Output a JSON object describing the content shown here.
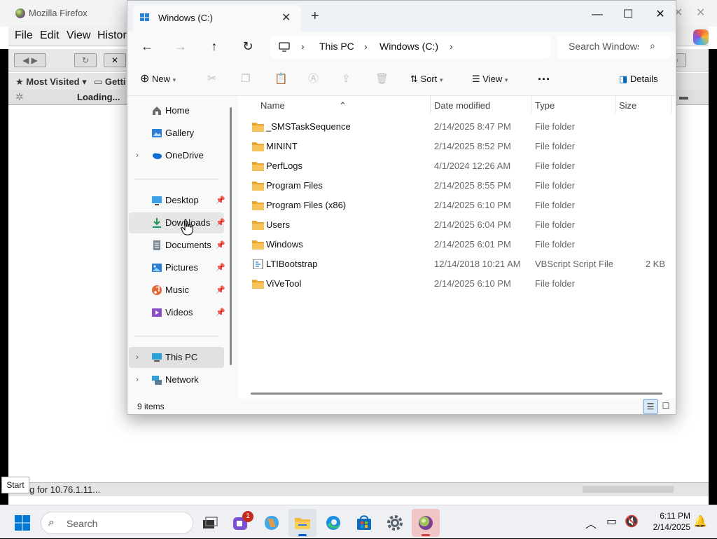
{
  "firefox": {
    "title": "Mozilla Firefox",
    "menu": [
      "File",
      "Edit",
      "View",
      "Histor"
    ],
    "bookmarks": [
      "Most Visited",
      "Getti"
    ],
    "tab_label": "Loading...",
    "status": "ing for 10.76.1.11..."
  },
  "tooltip": {
    "start": "Start"
  },
  "explorer": {
    "tab_title": "Windows (C:)",
    "breadcrumb": [
      "This PC",
      "Windows (C:)"
    ],
    "search_placeholder": "Search Windows (C:)",
    "commands": {
      "new": "New",
      "sort": "Sort",
      "view": "View",
      "details": "Details"
    },
    "nav": {
      "quick": [
        {
          "label": "Home",
          "icon": "home-icon"
        },
        {
          "label": "Gallery",
          "icon": "gallery-icon"
        },
        {
          "label": "OneDrive",
          "icon": "onedrive-icon"
        }
      ],
      "pinned": [
        {
          "label": "Desktop",
          "icon": "desktop-icon"
        },
        {
          "label": "Downloads",
          "icon": "downloads-icon"
        },
        {
          "label": "Documents",
          "icon": "documents-icon"
        },
        {
          "label": "Pictures",
          "icon": "pictures-icon"
        },
        {
          "label": "Music",
          "icon": "music-icon"
        },
        {
          "label": "Videos",
          "icon": "videos-icon"
        }
      ],
      "drives": [
        {
          "label": "This PC",
          "icon": "this-pc-icon"
        },
        {
          "label": "Network",
          "icon": "network-icon"
        }
      ]
    },
    "columns": {
      "name": "Name",
      "date": "Date modified",
      "type": "Type",
      "size": "Size"
    },
    "files": [
      {
        "name": "_SMSTaskSequence",
        "date": "2/14/2025 8:47 PM",
        "type": "File folder",
        "size": ""
      },
      {
        "name": "MININT",
        "date": "2/14/2025 8:52 PM",
        "type": "File folder",
        "size": ""
      },
      {
        "name": "PerfLogs",
        "date": "4/1/2024 12:26 AM",
        "type": "File folder",
        "size": ""
      },
      {
        "name": "Program Files",
        "date": "2/14/2025 8:55 PM",
        "type": "File folder",
        "size": ""
      },
      {
        "name": "Program Files (x86)",
        "date": "2/14/2025 6:10 PM",
        "type": "File folder",
        "size": ""
      },
      {
        "name": "Users",
        "date": "2/14/2025 6:04 PM",
        "type": "File folder",
        "size": ""
      },
      {
        "name": "Windows",
        "date": "2/14/2025 6:01 PM",
        "type": "File folder",
        "size": ""
      },
      {
        "name": "LTIBootstrap",
        "date": "12/14/2018 10:21 AM",
        "type": "VBScript Script File",
        "size": "2 KB"
      },
      {
        "name": "ViVeTool",
        "date": "2/14/2025 6:10 PM",
        "type": "File folder",
        "size": ""
      }
    ],
    "status": "9 items"
  },
  "taskbar": {
    "search_label": "Search",
    "chat_badge": "1",
    "time": "6:11 PM",
    "date": "2/14/2025"
  },
  "colors": {
    "accent": "#0067c0",
    "folder": "#f5c35a",
    "nav_hover": "#e6e6e6",
    "nav_selected": "#e1e1e1"
  }
}
